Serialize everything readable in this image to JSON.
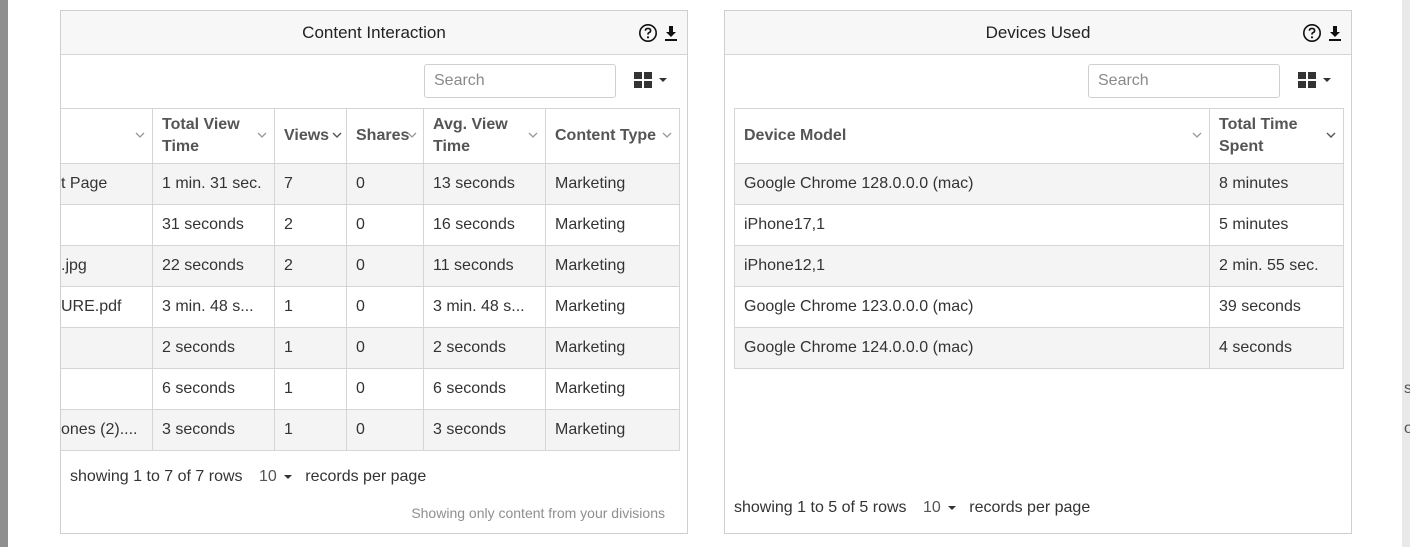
{
  "edge_right_glyphs": [
    "s",
    "o"
  ],
  "content_panel": {
    "title": "Content Interaction",
    "search_placeholder": "Search",
    "columns": [
      "",
      "Total View Time",
      "Views",
      "Shares",
      "Avg. View Time",
      "Content Type"
    ],
    "rows": [
      [
        "t Page",
        "1 min. 31 sec.",
        "7",
        "0",
        "13 seconds",
        "Marketing"
      ],
      [
        "",
        "31 seconds",
        "2",
        "0",
        "16 seconds",
        "Marketing"
      ],
      [
        ".jpg",
        "22 seconds",
        "2",
        "0",
        "11 seconds",
        "Marketing"
      ],
      [
        "URE.pdf",
        "3 min. 48 s...",
        "1",
        "0",
        "3 min. 48 s...",
        "Marketing"
      ],
      [
        "",
        "2 seconds",
        "1",
        "0",
        "2 seconds",
        "Marketing"
      ],
      [
        "",
        "6 seconds",
        "1",
        "0",
        "6 seconds",
        "Marketing"
      ],
      [
        "ones (2)....",
        "3 seconds",
        "1",
        "0",
        "3 seconds",
        "Marketing"
      ]
    ],
    "pagination_text": "showing 1 to 7 of 7 rows",
    "page_size": "10",
    "per_page_label": "records per page",
    "note": "Showing only content from your divisions"
  },
  "devices_panel": {
    "title": "Devices Used",
    "search_placeholder": "Search",
    "columns": [
      "Device Model",
      "Total Time Spent"
    ],
    "rows": [
      [
        "Google Chrome 128.0.0.0 (mac)",
        "8 minutes"
      ],
      [
        "iPhone17,1",
        "5 minutes"
      ],
      [
        "iPhone12,1",
        "2 min. 55 sec."
      ],
      [
        "Google Chrome 123.0.0.0 (mac)",
        "39 seconds"
      ],
      [
        "Google Chrome 124.0.0.0 (mac)",
        "4 seconds"
      ]
    ],
    "pagination_text": "showing 1 to 5 of 5 rows",
    "page_size": "10",
    "per_page_label": "records per page"
  }
}
